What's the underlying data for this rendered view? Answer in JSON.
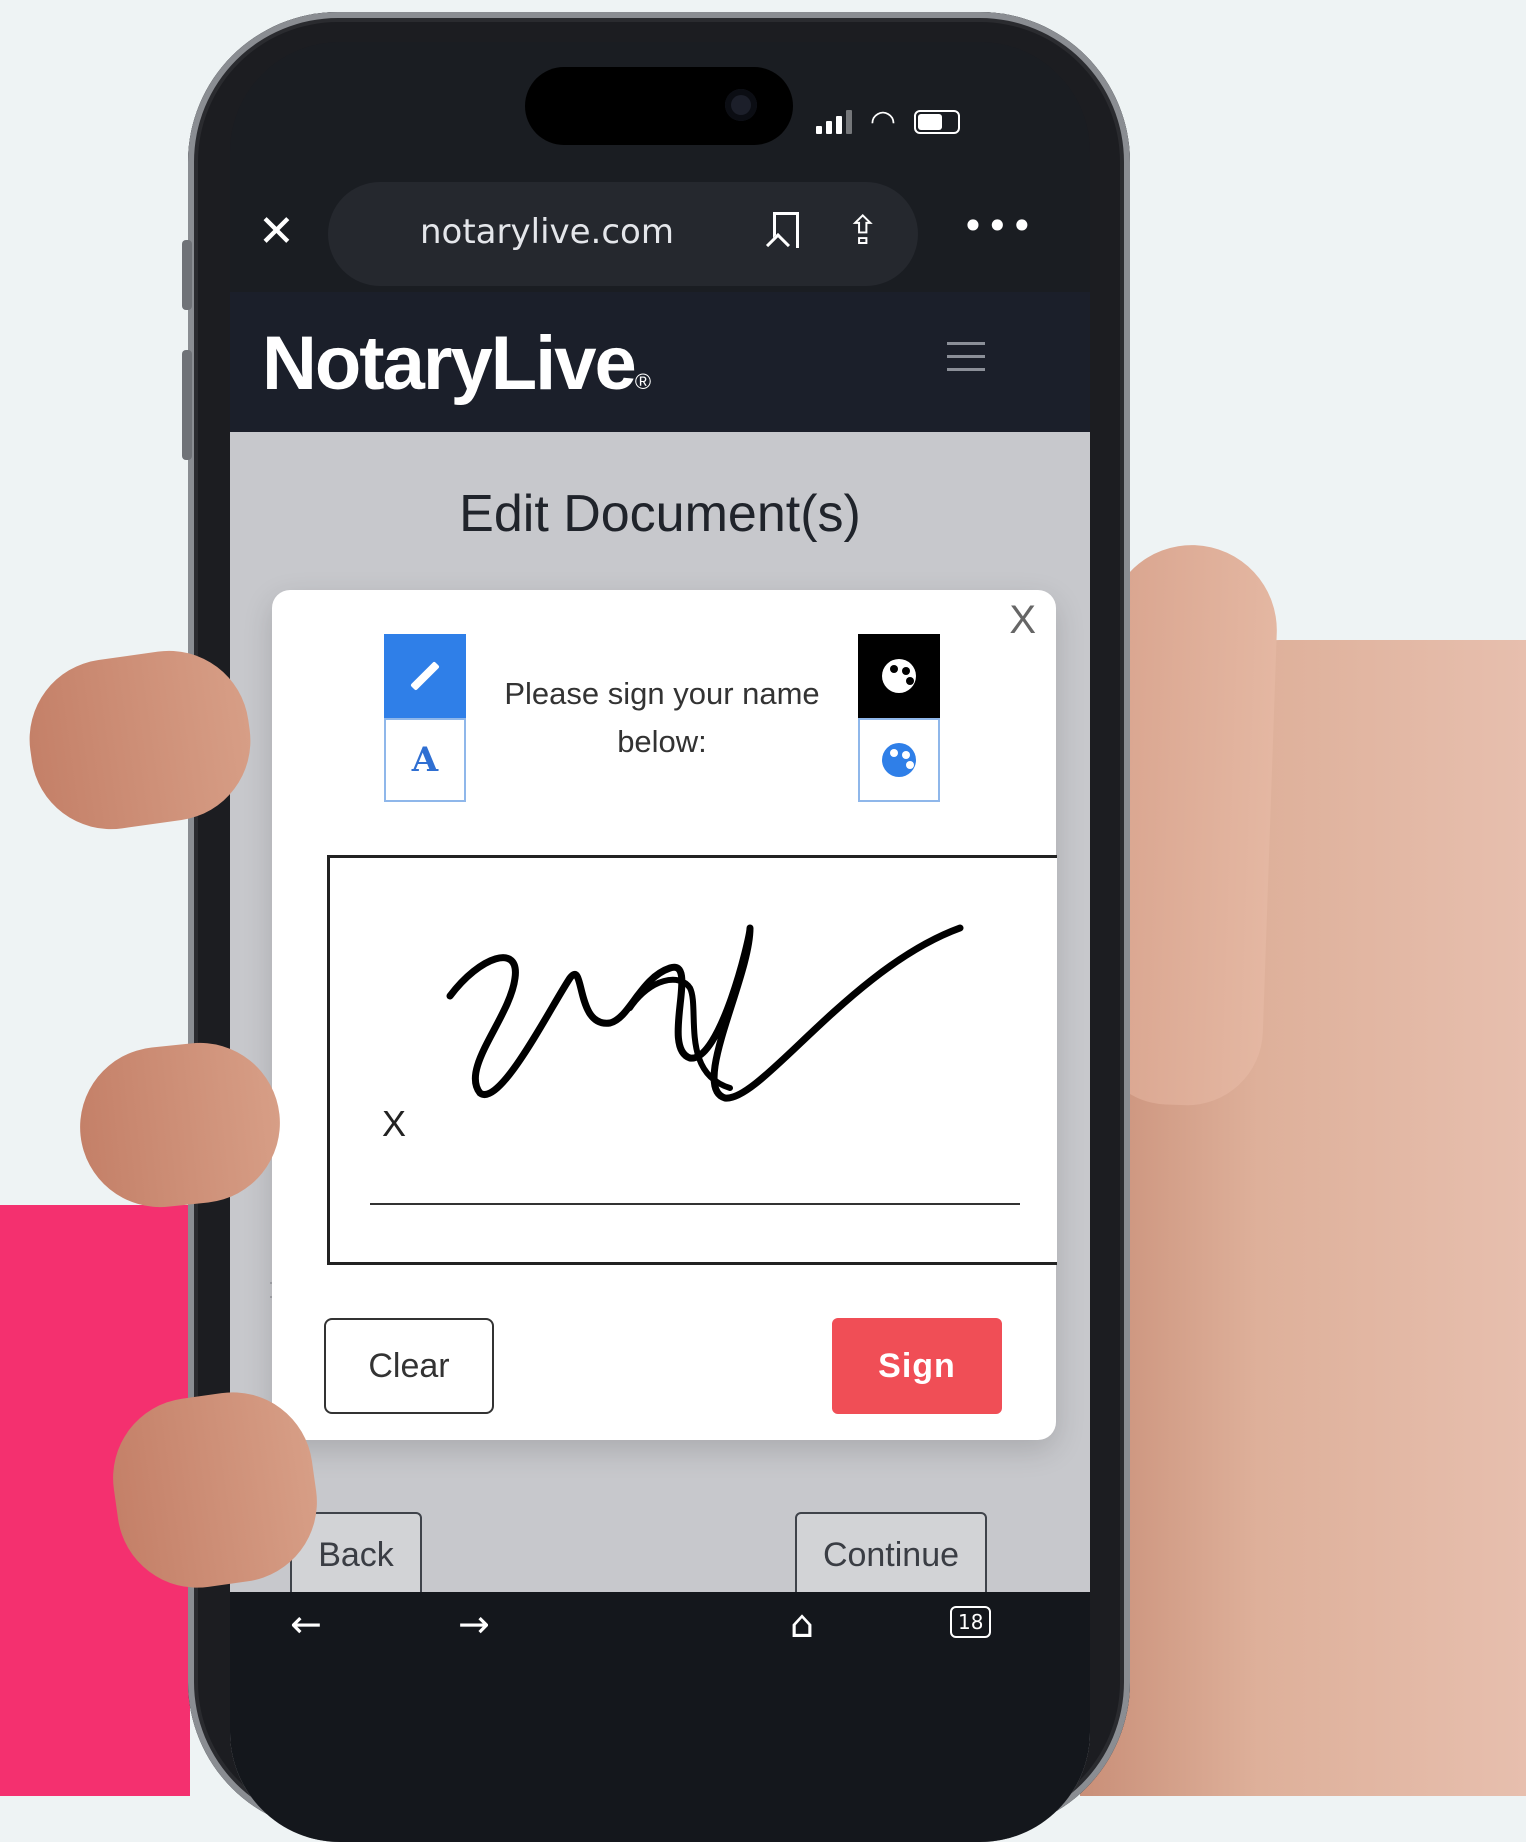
{
  "browser": {
    "url": "notarylive.com",
    "tab_count": "18"
  },
  "site": {
    "logo_text": "NotaryLive",
    "logo_mark": "®"
  },
  "page": {
    "title": "Edit Document(s)",
    "back_label": "Back",
    "continue_label": "Continue"
  },
  "signature_modal": {
    "close_label": "X",
    "prompt": "Please sign your name below:",
    "type_tool_label": "A",
    "signature_x": "X",
    "clear_label": "Clear",
    "sign_label": "Sign"
  },
  "colors": {
    "accent_pink": "#f4306f",
    "sign_button": "#f04e56",
    "tool_active_blue": "#2f7fe8",
    "site_header": "#1b1f2a"
  },
  "icons": [
    "close-icon",
    "bookmark-icon",
    "share-icon",
    "more-icon",
    "hamburger-icon",
    "pencil-icon",
    "palette-icon",
    "back-arrow-icon",
    "forward-arrow-icon",
    "home-icon",
    "tabs-icon"
  ]
}
